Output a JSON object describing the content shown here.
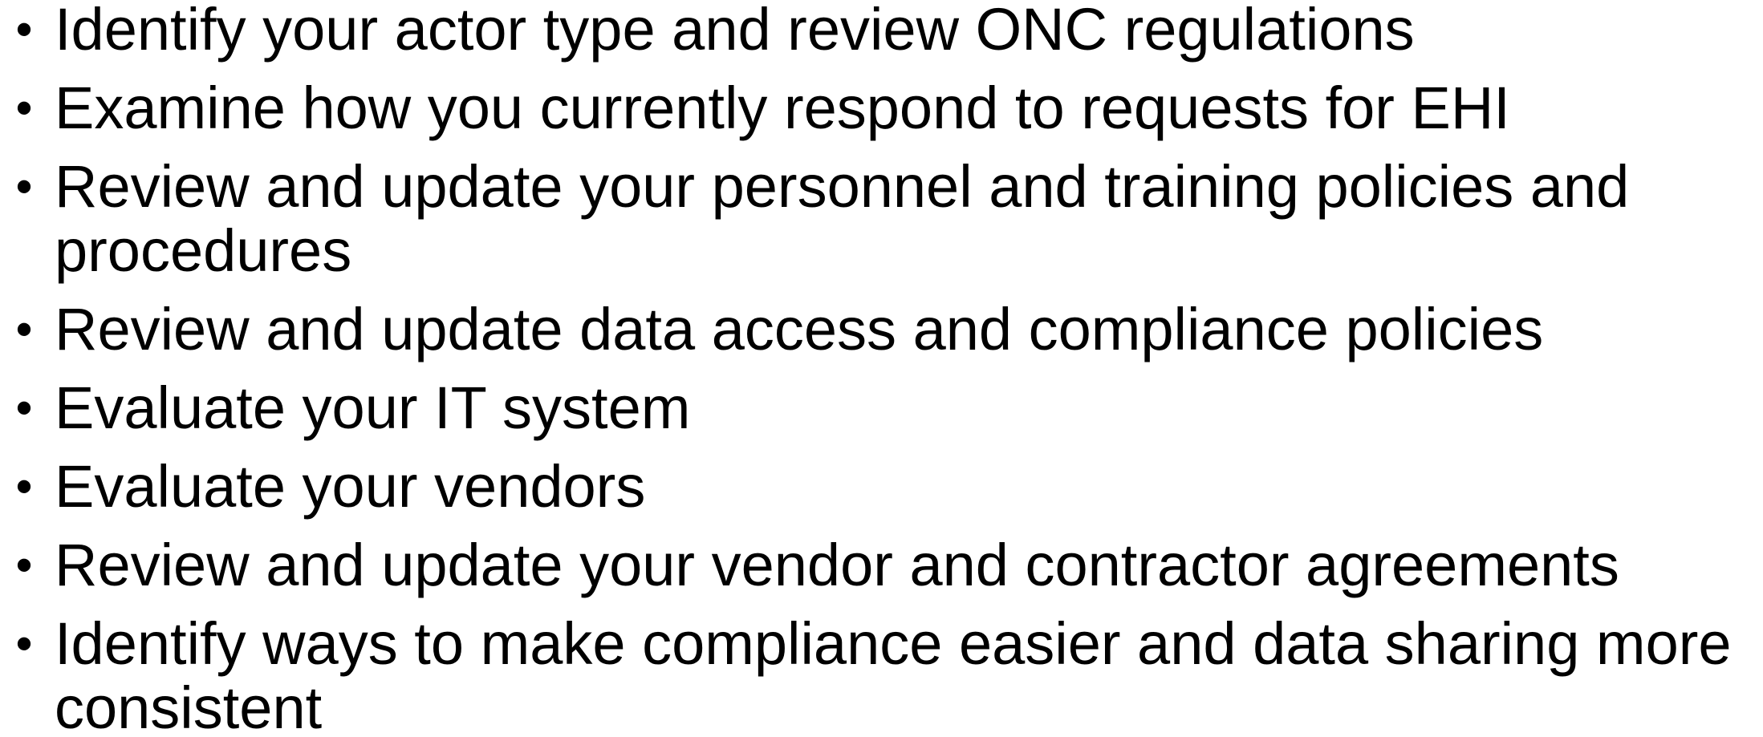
{
  "bullet_glyph": "•",
  "items": [
    {
      "text": "Identify your actor type and review ONC regulations"
    },
    {
      "text": "Examine how you currently respond to requests for EHI"
    },
    {
      "text": "Review and update your personnel and training policies and procedures"
    },
    {
      "text": "Review and update data access and compliance policies"
    },
    {
      "text": "Evaluate your IT system"
    },
    {
      "text": "Evaluate your vendors"
    },
    {
      "text": "Review and update your vendor and contractor agreements"
    },
    {
      "text": "Identify ways to make compliance easier and data sharing more consistent"
    }
  ]
}
